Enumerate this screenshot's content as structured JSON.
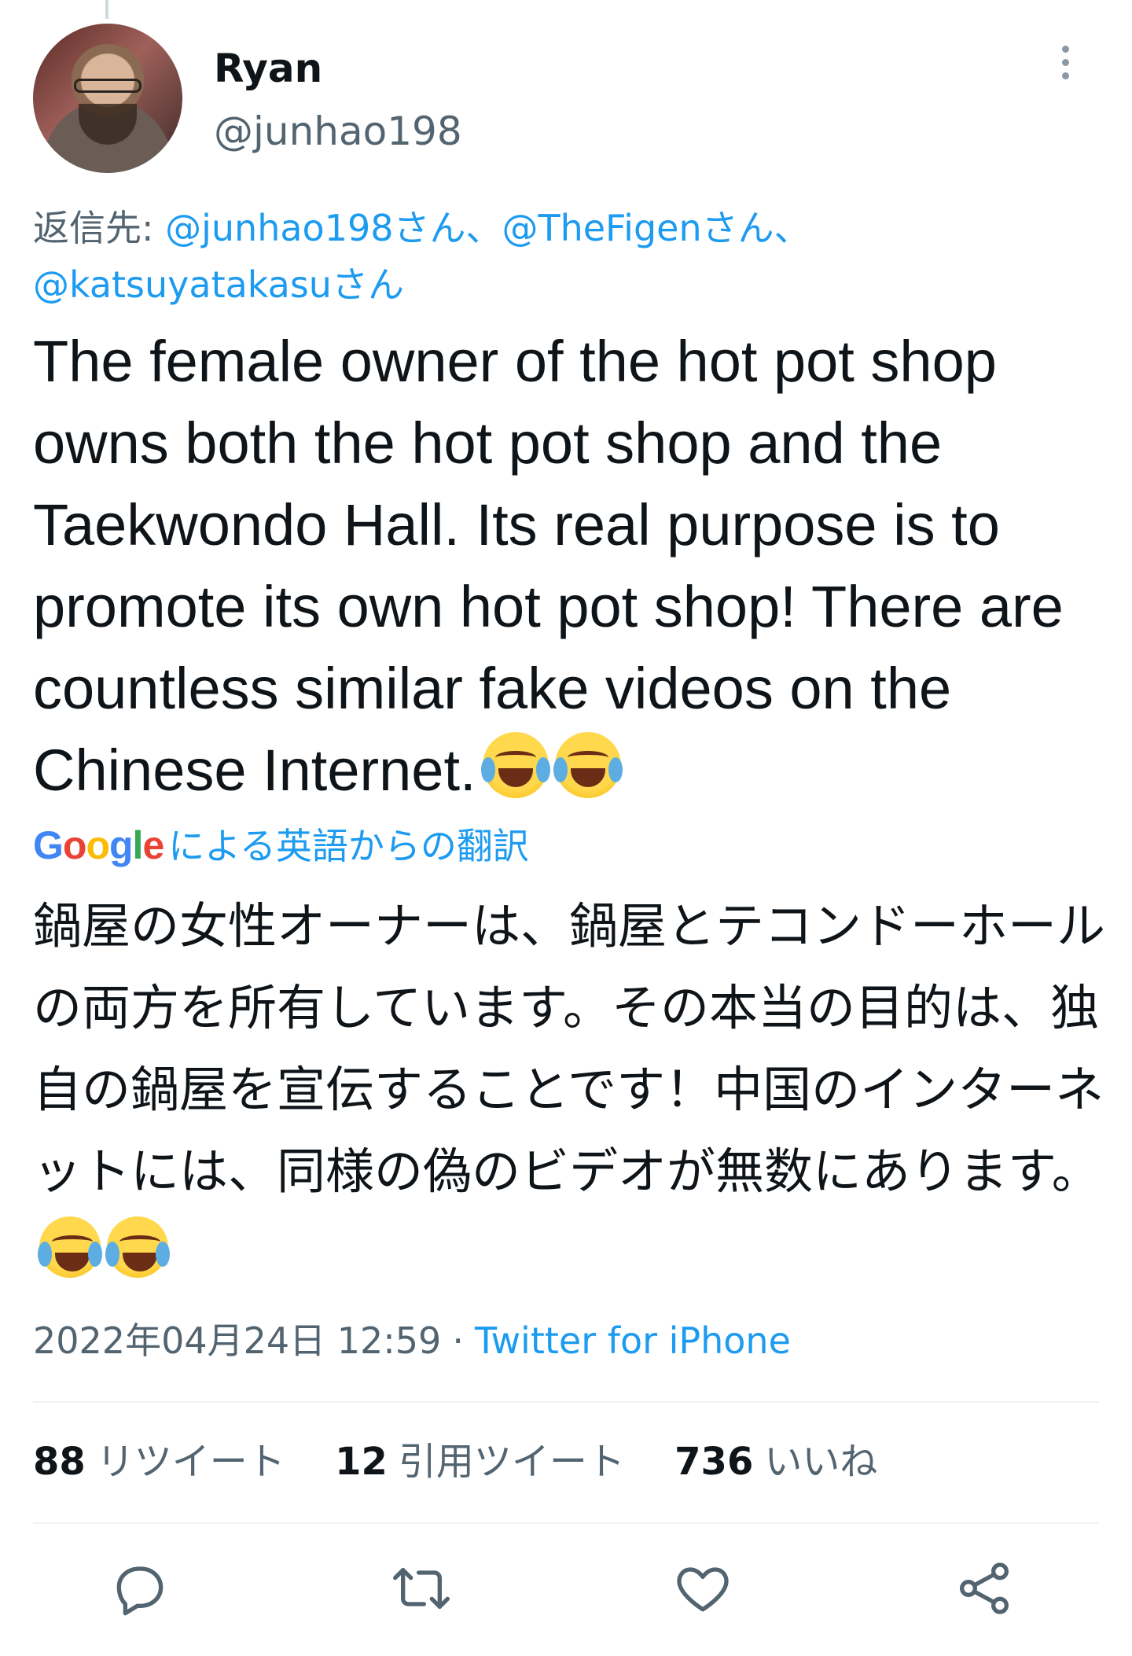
{
  "author": {
    "name": "Ryan",
    "handle": "@junhao198"
  },
  "reply": {
    "prefix": "返信先: ",
    "mentions": [
      "@junhao198さん、",
      "@TheFigenさん、",
      "@katsuyatakasuさん"
    ]
  },
  "tweet": {
    "text": "The female owner of the hot pot shop owns both the hot pot shop and the Taekwondo Hall. Its real purpose is to promote its own hot pot shop! There are countless similar fake videos on the Chinese Internet.",
    "emoji": "joy-emoji"
  },
  "translation": {
    "google_letters": [
      "G",
      "o",
      "o",
      "g",
      "l",
      "e"
    ],
    "label": "による英語からの翻訳",
    "text": "鍋屋の女性オーナーは、鍋屋とテコンドーホールの両方を所有しています。その本当の目的は、独自の鍋屋を宣伝することです！中国のインターネットには、同様の偽のビデオが無数にあります。"
  },
  "meta": {
    "timestamp": "2022年04月24日 12:59",
    "separator": "·",
    "source": "Twitter for iPhone"
  },
  "stats": {
    "retweets": {
      "count": "88",
      "label": "リツイート"
    },
    "quotes": {
      "count": "12",
      "label": "引用ツイート"
    },
    "likes": {
      "count": "736",
      "label": "いいね"
    }
  },
  "actions": [
    "reply-icon",
    "retweet-icon",
    "like-icon",
    "share-icon"
  ],
  "colors": {
    "link": "#1d9bf0",
    "secondary": "#536471",
    "primary": "#0f1419"
  }
}
